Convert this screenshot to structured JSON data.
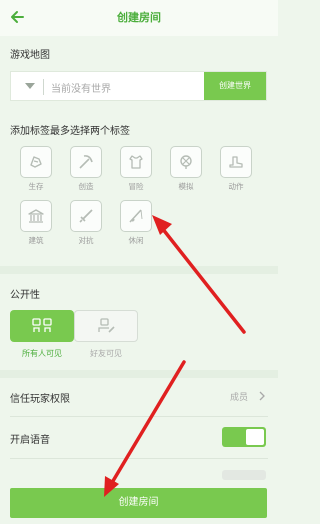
{
  "header": {
    "title": "创建房间"
  },
  "map": {
    "label": "游戏地图",
    "placeholder": "当前没有世界",
    "create_world": "创建世界"
  },
  "tags": {
    "label": "添加标签最多选择两个标签",
    "items": [
      "生存",
      "创造",
      "冒险",
      "模拟",
      "动作",
      "建筑",
      "对抗",
      "休闲"
    ]
  },
  "publicity": {
    "label": "公开性",
    "options": [
      "所有人可见",
      "好友可见"
    ]
  },
  "trust": {
    "label": "信任玩家权限",
    "value": "成员"
  },
  "voice": {
    "label": "开启语音",
    "enabled": true
  },
  "create_button": "创建房间",
  "colors": {
    "accent": "#79c94f",
    "title": "#4cae3c",
    "arrow": "#e02020"
  }
}
